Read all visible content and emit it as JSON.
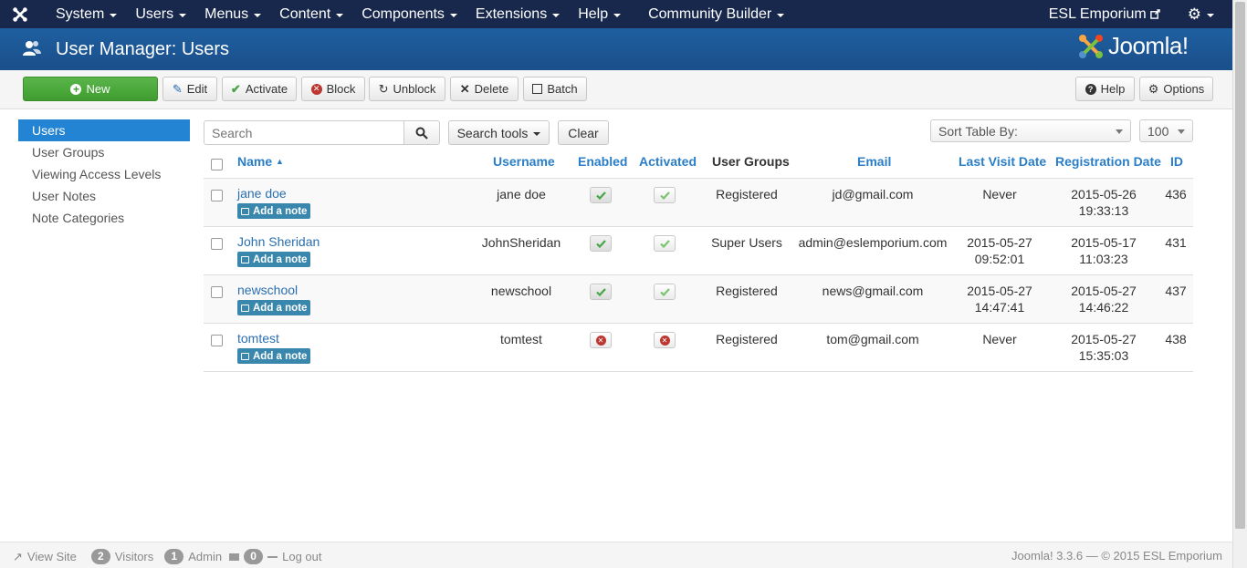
{
  "navbar": {
    "menus": [
      "System",
      "Users",
      "Menus",
      "Content",
      "Components",
      "Extensions",
      "Help",
      "Community Builder"
    ],
    "site_name": "ESL Emporium"
  },
  "header": {
    "title": "User Manager: Users",
    "logo_text": "Joomla!"
  },
  "toolbar": {
    "new": "New",
    "edit": "Edit",
    "activate": "Activate",
    "block": "Block",
    "unblock": "Unblock",
    "delete": "Delete",
    "batch": "Batch",
    "help": "Help",
    "options": "Options"
  },
  "sidebar": {
    "items": [
      {
        "label": "Users",
        "active": true
      },
      {
        "label": "User Groups"
      },
      {
        "label": "Viewing Access Levels"
      },
      {
        "label": "User Notes"
      },
      {
        "label": "Note Categories"
      }
    ]
  },
  "filters": {
    "search_placeholder": "Search",
    "search_tools": "Search tools",
    "clear": "Clear",
    "sort_label": "Sort Table By:",
    "limit": "100"
  },
  "table": {
    "headers": {
      "name": "Name",
      "username": "Username",
      "enabled": "Enabled",
      "activated": "Activated",
      "groups": "User Groups",
      "email": "Email",
      "last_visit": "Last Visit Date",
      "registration": "Registration Date",
      "id": "ID"
    },
    "add_note": "Add a note",
    "rows": [
      {
        "name": "jane doe",
        "username": "jane doe",
        "enabled": true,
        "activated": true,
        "groups": "Registered",
        "email": "jd@gmail.com",
        "last_visit": "Never",
        "last_visit_time": "",
        "reg_date": "2015-05-26",
        "reg_time": "19:33:13",
        "id": "436"
      },
      {
        "name": "John Sheridan",
        "username": "JohnSheridan",
        "enabled": true,
        "activated": true,
        "groups": "Super Users",
        "email": "admin@eslemporium.com",
        "last_visit": "2015-05-27",
        "last_visit_time": "09:52:01",
        "reg_date": "2015-05-17",
        "reg_time": "11:03:23",
        "id": "431"
      },
      {
        "name": "newschool",
        "username": "newschool",
        "enabled": true,
        "activated": true,
        "groups": "Registered",
        "email": "news@gmail.com",
        "last_visit": "2015-05-27",
        "last_visit_time": "14:47:41",
        "reg_date": "2015-05-27",
        "reg_time": "14:46:22",
        "id": "437"
      },
      {
        "name": "tomtest",
        "username": "tomtest",
        "enabled": false,
        "activated": false,
        "groups": "Registered",
        "email": "tom@gmail.com",
        "last_visit": "Never",
        "last_visit_time": "",
        "reg_date": "2015-05-27",
        "reg_time": "15:35:03",
        "id": "438"
      }
    ]
  },
  "footer": {
    "view_site": "View Site",
    "visitors_count": "2",
    "visitors": "Visitors",
    "admin_count": "1",
    "admin": "Admin",
    "messages_count": "0",
    "logout": "Log out",
    "version": "Joomla! 3.3.6",
    "copyright": "— © 2015 ESL Emporium"
  },
  "colors": {
    "navbar": "#17284c",
    "header": "#1a4f8a",
    "accent": "#2384d3",
    "new_button": "#46a546",
    "note_button": "#3a87ad"
  }
}
